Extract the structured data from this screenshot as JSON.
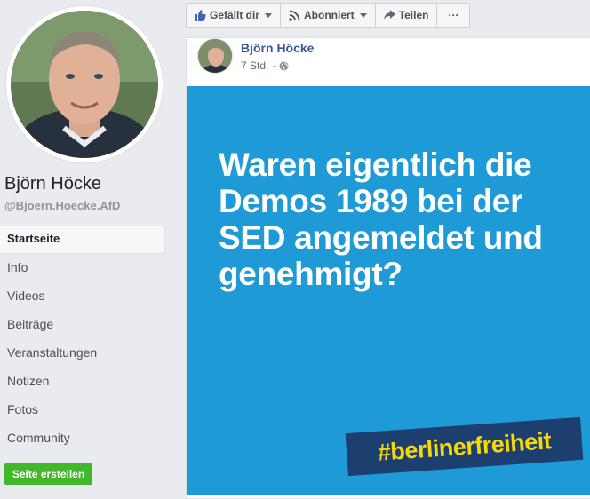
{
  "sidebar": {
    "page_name": "Björn Höcke",
    "handle": "@Bjoern.Hoecke.AfD",
    "nav": [
      {
        "label": "Startseite",
        "active": true
      },
      {
        "label": "Info"
      },
      {
        "label": "Videos"
      },
      {
        "label": "Beiträge"
      },
      {
        "label": "Veranstaltungen"
      },
      {
        "label": "Notizen"
      },
      {
        "label": "Fotos"
      },
      {
        "label": "Community"
      }
    ],
    "create_page_label": "Seite erstellen"
  },
  "actions": {
    "like_label": "Gefällt dir",
    "subscribe_label": "Abonniert",
    "share_label": "Teilen",
    "more_label": "···"
  },
  "post": {
    "author": "Björn Höcke",
    "time": "7 Std.",
    "privacy_icon": "globe-icon",
    "image": {
      "headline": "Waren eigentlich die Demos 1989 bei der SED angemeldet und genehmigt?",
      "hashtag": "#berlinerfreiheit",
      "background_color": "#1e9ad6",
      "banner_color": "#1c3f70",
      "hashtag_color": "#f5d80a"
    }
  },
  "colors": {
    "link_blue": "#365899",
    "button_green": "#42b72a",
    "page_bg": "#e9ebee"
  }
}
